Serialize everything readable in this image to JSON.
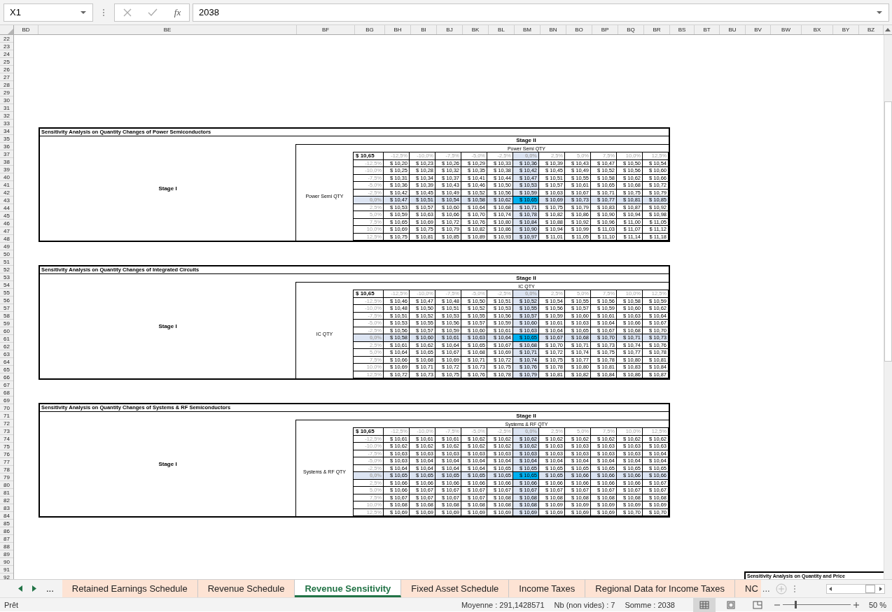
{
  "formula_bar": {
    "name_box": "X1",
    "function_label": "fx",
    "formula": "2038"
  },
  "column_headers": [
    "BD",
    "BE",
    "BF",
    "BG",
    "BH",
    "BI",
    "BJ",
    "BK",
    "BL",
    "BM",
    "BN",
    "BO",
    "BP",
    "BQ",
    "BR",
    "BS",
    "BT",
    "BU",
    "BV",
    "BW",
    "BX",
    "BY",
    "BZ"
  ],
  "row_numbers": [
    "22",
    "23",
    "24",
    "25",
    "26",
    "27",
    "28",
    "29",
    "30",
    "31",
    "32",
    "33",
    "34",
    "35",
    "36",
    "37",
    "38",
    "39",
    "40",
    "41",
    "42",
    "43",
    "44",
    "45",
    "46",
    "47",
    "48",
    "49",
    "50",
    "51",
    "52",
    "53",
    "54",
    "55",
    "56",
    "57",
    "58",
    "59",
    "60",
    "61",
    "62",
    "63",
    "64",
    "65",
    "66",
    "67",
    "68",
    "69",
    "70",
    "71",
    "72",
    "73",
    "74",
    "75",
    "76",
    "77",
    "78",
    "79",
    "80",
    "81",
    "82",
    "83",
    "84",
    "85",
    "86",
    "87",
    "88",
    "89",
    "90",
    "91",
    "92"
  ],
  "tables": [
    {
      "title": "Sensitivity Analysis on Quantity Changes of Power Semiconductors",
      "stage_1": "Stage I",
      "stage_2": "Stage II",
      "variable_label": "Power Semi QTY",
      "row_variable_label": "Power Semi QTY",
      "base_value": "$ 10,65",
      "columns": [
        {
          "label": "-12,5%",
          "highlighted": false
        },
        {
          "label": "-10,0%",
          "highlighted": false
        },
        {
          "label": "-7,5%",
          "highlighted": false
        },
        {
          "label": "-5,0%",
          "highlighted": false
        },
        {
          "label": "-2,5%",
          "highlighted": false
        },
        {
          "label": "0,0%",
          "highlighted": true
        },
        {
          "label": "2,5%",
          "highlighted": false
        },
        {
          "label": "5,0%",
          "highlighted": false
        },
        {
          "label": "7,5%",
          "highlighted": false
        },
        {
          "label": "10,0%",
          "highlighted": false
        },
        {
          "label": "12,5%",
          "highlighted": false
        }
      ],
      "rows": [
        {
          "label": "-12,5%",
          "highlighted": false,
          "values": [
            "$ 10,20",
            "$ 10,23",
            "$ 10,26",
            "$ 10,29",
            "$ 10,33",
            "$ 10,36",
            "$ 10,39",
            "$ 10,43",
            "$ 10,47",
            "$ 10,50",
            "$ 10,54"
          ]
        },
        {
          "label": "-10,0%",
          "highlighted": false,
          "values": [
            "$ 10,25",
            "$ 10,28",
            "$ 10,32",
            "$ 10,35",
            "$ 10,38",
            "$ 10,42",
            "$ 10,45",
            "$ 10,49",
            "$ 10,52",
            "$ 10,56",
            "$ 10,60"
          ]
        },
        {
          "label": "-7,5%",
          "highlighted": false,
          "values": [
            "$ 10,31",
            "$ 10,34",
            "$ 10,37",
            "$ 10,41",
            "$ 10,44",
            "$ 10,47",
            "$ 10,51",
            "$ 10,55",
            "$ 10,58",
            "$ 10,62",
            "$ 10,66"
          ]
        },
        {
          "label": "-5,0%",
          "highlighted": false,
          "values": [
            "$ 10,36",
            "$ 10,39",
            "$ 10,43",
            "$ 10,46",
            "$ 10,50",
            "$ 10,53",
            "$ 10,57",
            "$ 10,61",
            "$ 10,65",
            "$ 10,68",
            "$ 10,72"
          ]
        },
        {
          "label": "-2,5%",
          "highlighted": false,
          "values": [
            "$ 10,42",
            "$ 10,45",
            "$ 10,49",
            "$ 10,52",
            "$ 10,56",
            "$ 10,59",
            "$ 10,63",
            "$ 10,67",
            "$ 10,71",
            "$ 10,75",
            "$ 10,79"
          ]
        },
        {
          "label": "0,0%",
          "highlighted": true,
          "values": [
            "$ 10,47",
            "$ 10,51",
            "$ 10,54",
            "$ 10,58",
            "$ 10,62",
            "$ 10,65",
            "$ 10,69",
            "$ 10,73",
            "$ 10,77",
            "$ 10,81",
            "$ 10,85"
          ]
        },
        {
          "label": "2,5%",
          "highlighted": false,
          "values": [
            "$ 10,53",
            "$ 10,57",
            "$ 10,60",
            "$ 10,64",
            "$ 10,68",
            "$ 10,71",
            "$ 10,75",
            "$ 10,79",
            "$ 10,83",
            "$ 10,87",
            "$ 10,92"
          ]
        },
        {
          "label": "5,0%",
          "highlighted": false,
          "values": [
            "$ 10,59",
            "$ 10,63",
            "$ 10,66",
            "$ 10,70",
            "$ 10,74",
            "$ 10,78",
            "$ 10,82",
            "$ 10,86",
            "$ 10,90",
            "$ 10,94",
            "$ 10,98"
          ]
        },
        {
          "label": "7,5%",
          "highlighted": false,
          "values": [
            "$ 10,65",
            "$ 10,69",
            "$ 10,72",
            "$ 10,76",
            "$ 10,80",
            "$ 10,84",
            "$ 10,88",
            "$ 10,92",
            "$ 10,96",
            "$ 11,00",
            "$ 11,05"
          ]
        },
        {
          "label": "10,0%",
          "highlighted": false,
          "values": [
            "$ 10,69",
            "$ 10,75",
            "$ 10,79",
            "$ 10,82",
            "$ 10,86",
            "$ 10,90",
            "$ 10,94",
            "$ 10,99",
            "$ 11,03",
            "$ 11,07",
            "$ 11,12"
          ]
        },
        {
          "label": "12,5%",
          "highlighted": false,
          "values": [
            "$ 10,75",
            "$ 10,81",
            "$ 10,85",
            "$ 10,89",
            "$ 10,93",
            "$ 10,97",
            "$ 11,01",
            "$ 11,05",
            "$ 11,10",
            "$ 11,14",
            "$ 11,18"
          ]
        }
      ]
    },
    {
      "title": "Sensitivity Analysis on Quantity Changes of Integrated Circuits",
      "stage_1": "Stage I",
      "stage_2": "Stage II",
      "variable_label": "IC QTY",
      "row_variable_label": "IC QTY",
      "base_value": "$ 10,65",
      "columns": [
        {
          "label": "-12,5%",
          "highlighted": false
        },
        {
          "label": "-10,0%",
          "highlighted": false
        },
        {
          "label": "-7,5%",
          "highlighted": false
        },
        {
          "label": "-5,0%",
          "highlighted": false
        },
        {
          "label": "-2,5%",
          "highlighted": false
        },
        {
          "label": "0,0%",
          "highlighted": true
        },
        {
          "label": "2,5%",
          "highlighted": false
        },
        {
          "label": "5,0%",
          "highlighted": false
        },
        {
          "label": "7,5%",
          "highlighted": false
        },
        {
          "label": "10,0%",
          "highlighted": false
        },
        {
          "label": "12,5%",
          "highlighted": false
        }
      ],
      "rows": [
        {
          "label": "-12,5%",
          "highlighted": false,
          "values": [
            "$ 10,46",
            "$ 10,47",
            "$ 10,48",
            "$ 10,50",
            "$ 10,51",
            "$ 10,52",
            "$ 10,54",
            "$ 10,55",
            "$ 10,56",
            "$ 10,58",
            "$ 10,59"
          ]
        },
        {
          "label": "-10,0%",
          "highlighted": false,
          "values": [
            "$ 10,48",
            "$ 10,50",
            "$ 10,51",
            "$ 10,52",
            "$ 10,53",
            "$ 10,55",
            "$ 10,56",
            "$ 10,57",
            "$ 10,59",
            "$ 10,60",
            "$ 10,62"
          ]
        },
        {
          "label": "-7,5%",
          "highlighted": false,
          "values": [
            "$ 10,51",
            "$ 10,52",
            "$ 10,53",
            "$ 10,55",
            "$ 10,56",
            "$ 10,57",
            "$ 10,59",
            "$ 10,60",
            "$ 10,61",
            "$ 10,63",
            "$ 10,64"
          ]
        },
        {
          "label": "-5,0%",
          "highlighted": false,
          "values": [
            "$ 10,53",
            "$ 10,55",
            "$ 10,56",
            "$ 10,57",
            "$ 10,59",
            "$ 10,60",
            "$ 10,61",
            "$ 10,63",
            "$ 10,64",
            "$ 10,66",
            "$ 10,67"
          ]
        },
        {
          "label": "-2,5%",
          "highlighted": false,
          "values": [
            "$ 10,56",
            "$ 10,57",
            "$ 10,59",
            "$ 10,60",
            "$ 10,61",
            "$ 10,63",
            "$ 10,64",
            "$ 10,65",
            "$ 10,67",
            "$ 10,68",
            "$ 10,70"
          ]
        },
        {
          "label": "0,0%",
          "highlighted": true,
          "values": [
            "$ 10,58",
            "$ 10,60",
            "$ 10,61",
            "$ 10,63",
            "$ 10,64",
            "$ 10,65",
            "$ 10,67",
            "$ 10,68",
            "$ 10,70",
            "$ 10,71",
            "$ 10,73"
          ]
        },
        {
          "label": "2,5%",
          "highlighted": false,
          "values": [
            "$ 10,61",
            "$ 10,62",
            "$ 10,64",
            "$ 10,65",
            "$ 10,67",
            "$ 10,68",
            "$ 10,70",
            "$ 10,71",
            "$ 10,73",
            "$ 10,74",
            "$ 10,76"
          ]
        },
        {
          "label": "5,0%",
          "highlighted": false,
          "values": [
            "$ 10,64",
            "$ 10,65",
            "$ 10,67",
            "$ 10,68",
            "$ 10,69",
            "$ 10,71",
            "$ 10,72",
            "$ 10,74",
            "$ 10,75",
            "$ 10,77",
            "$ 10,78"
          ]
        },
        {
          "label": "7,5%",
          "highlighted": false,
          "values": [
            "$ 10,66",
            "$ 10,68",
            "$ 10,69",
            "$ 10,71",
            "$ 10,72",
            "$ 10,74",
            "$ 10,75",
            "$ 10,77",
            "$ 10,78",
            "$ 10,80",
            "$ 10,81"
          ]
        },
        {
          "label": "10,0%",
          "highlighted": false,
          "values": [
            "$ 10,69",
            "$ 10,71",
            "$ 10,72",
            "$ 10,73",
            "$ 10,75",
            "$ 10,76",
            "$ 10,78",
            "$ 10,80",
            "$ 10,81",
            "$ 10,83",
            "$ 10,84"
          ]
        },
        {
          "label": "12,5%",
          "highlighted": false,
          "values": [
            "$ 10,72",
            "$ 10,73",
            "$ 10,75",
            "$ 10,76",
            "$ 10,78",
            "$ 10,79",
            "$ 10,81",
            "$ 10,82",
            "$ 10,84",
            "$ 10,86",
            "$ 10,87"
          ]
        }
      ]
    },
    {
      "title": "Sensitivity Analysis on Quantity Changes of Systems & RF Semiconductors",
      "stage_1": "Stage I",
      "stage_2": "Stage II",
      "variable_label": "Systems & RF QTY",
      "row_variable_label": "Systems & RF QTY",
      "base_value": "$ 10,65",
      "columns": [
        {
          "label": "-12,5%",
          "highlighted": false
        },
        {
          "label": "-10,0%",
          "highlighted": false
        },
        {
          "label": "-7,5%",
          "highlighted": false
        },
        {
          "label": "-5,0%",
          "highlighted": false
        },
        {
          "label": "-2,5%",
          "highlighted": false
        },
        {
          "label": "0,0%",
          "highlighted": true
        },
        {
          "label": "2,5%",
          "highlighted": false
        },
        {
          "label": "5,0%",
          "highlighted": false
        },
        {
          "label": "7,5%",
          "highlighted": false
        },
        {
          "label": "10,0%",
          "highlighted": false
        },
        {
          "label": "12,5%",
          "highlighted": false
        }
      ],
      "rows": [
        {
          "label": "-12,5%",
          "highlighted": false,
          "values": [
            "$ 10,61",
            "$ 10,61",
            "$ 10,61",
            "$ 10,62",
            "$ 10,62",
            "$ 10,62",
            "$ 10,62",
            "$ 10,62",
            "$ 10,62",
            "$ 10,62",
            "$ 10,62"
          ]
        },
        {
          "label": "-10,0%",
          "highlighted": false,
          "values": [
            "$ 10,62",
            "$ 10,62",
            "$ 10,62",
            "$ 10,62",
            "$ 10,62",
            "$ 10,62",
            "$ 10,63",
            "$ 10,63",
            "$ 10,63",
            "$ 10,63",
            "$ 10,63"
          ]
        },
        {
          "label": "-7,5%",
          "highlighted": false,
          "values": [
            "$ 10,63",
            "$ 10,63",
            "$ 10,63",
            "$ 10,63",
            "$ 10,63",
            "$ 10,63",
            "$ 10,63",
            "$ 10,63",
            "$ 10,63",
            "$ 10,63",
            "$ 10,64"
          ]
        },
        {
          "label": "-5,0%",
          "highlighted": false,
          "values": [
            "$ 10,63",
            "$ 10,64",
            "$ 10,64",
            "$ 10,64",
            "$ 10,64",
            "$ 10,64",
            "$ 10,64",
            "$ 10,64",
            "$ 10,64",
            "$ 10,64",
            "$ 10,64"
          ]
        },
        {
          "label": "-2,5%",
          "highlighted": false,
          "values": [
            "$ 10,64",
            "$ 10,64",
            "$ 10,64",
            "$ 10,64",
            "$ 10,65",
            "$ 10,65",
            "$ 10,65",
            "$ 10,65",
            "$ 10,65",
            "$ 10,65",
            "$ 10,65"
          ]
        },
        {
          "label": "0,0%",
          "highlighted": true,
          "values": [
            "$ 10,65",
            "$ 10,65",
            "$ 10,65",
            "$ 10,65",
            "$ 10,65",
            "$ 10,65",
            "$ 10,65",
            "$ 10,66",
            "$ 10,66",
            "$ 10,66",
            "$ 10,66"
          ]
        },
        {
          "label": "2,5%",
          "highlighted": false,
          "values": [
            "$ 10,66",
            "$ 10,66",
            "$ 10,66",
            "$ 10,66",
            "$ 10,66",
            "$ 10,66",
            "$ 10,66",
            "$ 10,66",
            "$ 10,66",
            "$ 10,66",
            "$ 10,67"
          ]
        },
        {
          "label": "5,0%",
          "highlighted": false,
          "values": [
            "$ 10,66",
            "$ 10,67",
            "$ 10,67",
            "$ 10,67",
            "$ 10,67",
            "$ 10,67",
            "$ 10,67",
            "$ 10,67",
            "$ 10,67",
            "$ 10,67",
            "$ 10,67"
          ]
        },
        {
          "label": "7,5%",
          "highlighted": false,
          "values": [
            "$ 10,67",
            "$ 10,67",
            "$ 10,67",
            "$ 10,67",
            "$ 10,68",
            "$ 10,68",
            "$ 10,68",
            "$ 10,68",
            "$ 10,68",
            "$ 10,68",
            "$ 10,68"
          ]
        },
        {
          "label": "10,0%",
          "highlighted": false,
          "values": [
            "$ 10,68",
            "$ 10,68",
            "$ 10,68",
            "$ 10,68",
            "$ 10,68",
            "$ 10,68",
            "$ 10,69",
            "$ 10,69",
            "$ 10,69",
            "$ 10,69",
            "$ 10,69"
          ]
        },
        {
          "label": "12,5%",
          "highlighted": false,
          "values": [
            "$ 10,69",
            "$ 10,69",
            "$ 10,69",
            "$ 10,69",
            "$ 10,69",
            "$ 10,69",
            "$ 10,69",
            "$ 10,69",
            "$ 10,69",
            "$ 10,70",
            "$ 10,70"
          ]
        }
      ]
    }
  ],
  "partial_table": {
    "title": "Sensitivity Analysis on Quantity and Price"
  },
  "sheet_tabs": {
    "overflow_left": "...",
    "tabs": [
      {
        "label": "Retained Earnings Schedule",
        "selected": false
      },
      {
        "label": "Revenue Schedule",
        "selected": false
      },
      {
        "label": "Revenue Sensitivity",
        "selected": true
      },
      {
        "label": "Fixed Asset Schedule",
        "selected": false
      },
      {
        "label": "Income Taxes",
        "selected": false
      },
      {
        "label": "Regional Data for Income Taxes",
        "selected": false
      },
      {
        "label": "NC",
        "selected": false
      }
    ],
    "overflow_right": "..."
  },
  "status_bar": {
    "status": "Prêt",
    "average": "Moyenne : 291,1428571",
    "count": "Nb (non vides) : 7",
    "sum": "Somme : 2038",
    "views": [
      {
        "kind": "normal",
        "selected": true
      },
      {
        "kind": "page-layout",
        "selected": false
      },
      {
        "kind": "page-break",
        "selected": false
      }
    ],
    "zoom": {
      "level": 0.19,
      "label": "50 %"
    }
  }
}
